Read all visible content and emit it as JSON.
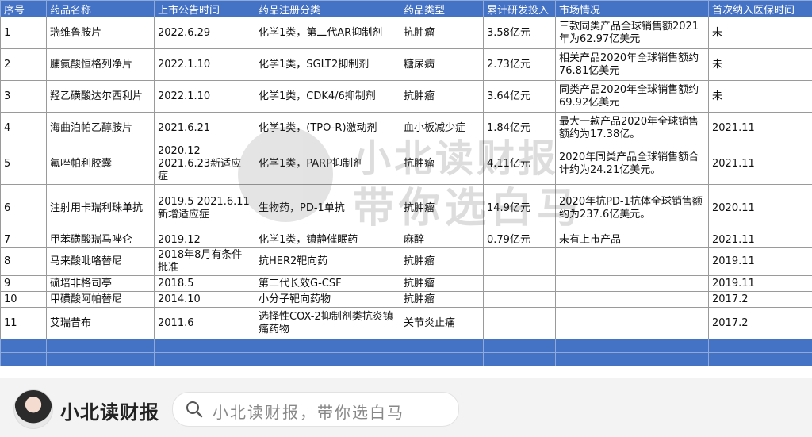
{
  "table": {
    "headers": [
      "序号",
      "药品名称",
      "上市公告时间",
      "药品注册分类",
      "药品类型",
      "累计研发投入",
      "市场情况",
      "首次纳入医保时间"
    ],
    "rows": [
      [
        "1",
        "瑞维鲁胺片",
        "2022.6.29",
        "化学1类，第二代AR抑制剂",
        "抗肿瘤",
        "3.58亿元",
        "三款同类产品全球销售额2021年为62.97亿美元",
        "未"
      ],
      [
        "2",
        "脯氨酸恒格列净片",
        "2022.1.10",
        "化学1类，SGLT2抑制剂",
        "糖尿病",
        "2.73亿元",
        "相关产品2020年全球销售额约76.81亿美元",
        "未"
      ],
      [
        "3",
        "羟乙磺酸达尔西利片",
        "2022.1.10",
        "化学1类，CDK4/6抑制剂",
        "抗肿瘤",
        "3.64亿元",
        "同类产品2020年全球销售额约69.92亿美元",
        "未"
      ],
      [
        "4",
        "海曲泊帕乙醇胺片",
        "2021.6.21",
        "化学1类，(TPO-R)激动剂",
        "血小板减少症",
        "1.84亿元",
        "最大一款产品2020年全球销售额约为17.38亿。",
        "2021.11"
      ],
      [
        "5",
        "氟唑帕利胶囊",
        "2020.12 2021.6.23新适应症",
        "化学1类，PARP抑制剂",
        "抗肿瘤",
        "4.11亿元",
        "2020年同类产品全球销售额合计约为24.21亿美元。",
        "2021.11"
      ],
      [
        "6",
        "注射用卡瑞利珠单抗",
        "2019.5 2021.6.11新增适应症",
        "生物药，PD-1单抗",
        "抗肿瘤",
        "14.9亿元",
        "2020年抗PD-1抗体全球销售额约为237.6亿美元。",
        "2020.11"
      ],
      [
        "7",
        "甲苯磺酸瑞马唑仑",
        "2019.12",
        "化学1类，镇静催眠药",
        "麻醉",
        "0.79亿元",
        "未有上市产品",
        "2021.11"
      ],
      [
        "8",
        "马来酸吡咯替尼",
        "2018年8月有条件批准",
        "抗HER2靶向药",
        "抗肿瘤",
        "",
        "",
        "2019.11"
      ],
      [
        "9",
        "硫培非格司亭",
        "2018.5",
        "第二代长效G-CSF",
        "抗肿瘤",
        "",
        "",
        "2019.11"
      ],
      [
        "10",
        "甲磺酸阿帕替尼",
        "2014.10",
        "小分子靶向药物",
        "抗肿瘤",
        "",
        "",
        "2017.2"
      ],
      [
        "11",
        "艾瑞昔布",
        "2011.6",
        "选择性COX-2抑制剂类抗炎镇痛药物",
        "关节炎止痛",
        "",
        "",
        "2017.2"
      ]
    ]
  },
  "watermark": {
    "line1": "小北读财报",
    "line2": "带你选白马"
  },
  "footer": {
    "brand": "小北读财报",
    "search_placeholder": "小北读财报，带你选白马",
    "icon": "search-icon",
    "accent": "#4472c4"
  }
}
